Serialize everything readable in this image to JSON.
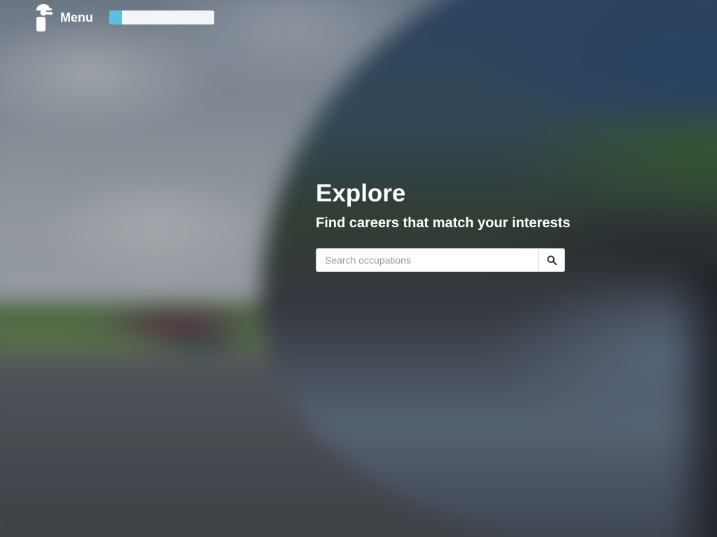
{
  "header": {
    "logo_icon": "explorer-person-icon",
    "menu_label": "Menu",
    "progress": {
      "value_fraction": 0.12,
      "fill_color": "#5bc0de",
      "track_color": "#f2f4f6"
    }
  },
  "hero": {
    "title": "Explore",
    "subtitle": "Find careers that match your interests"
  },
  "search": {
    "placeholder": "Search occupations",
    "value": "",
    "button_icon": "search-icon"
  }
}
